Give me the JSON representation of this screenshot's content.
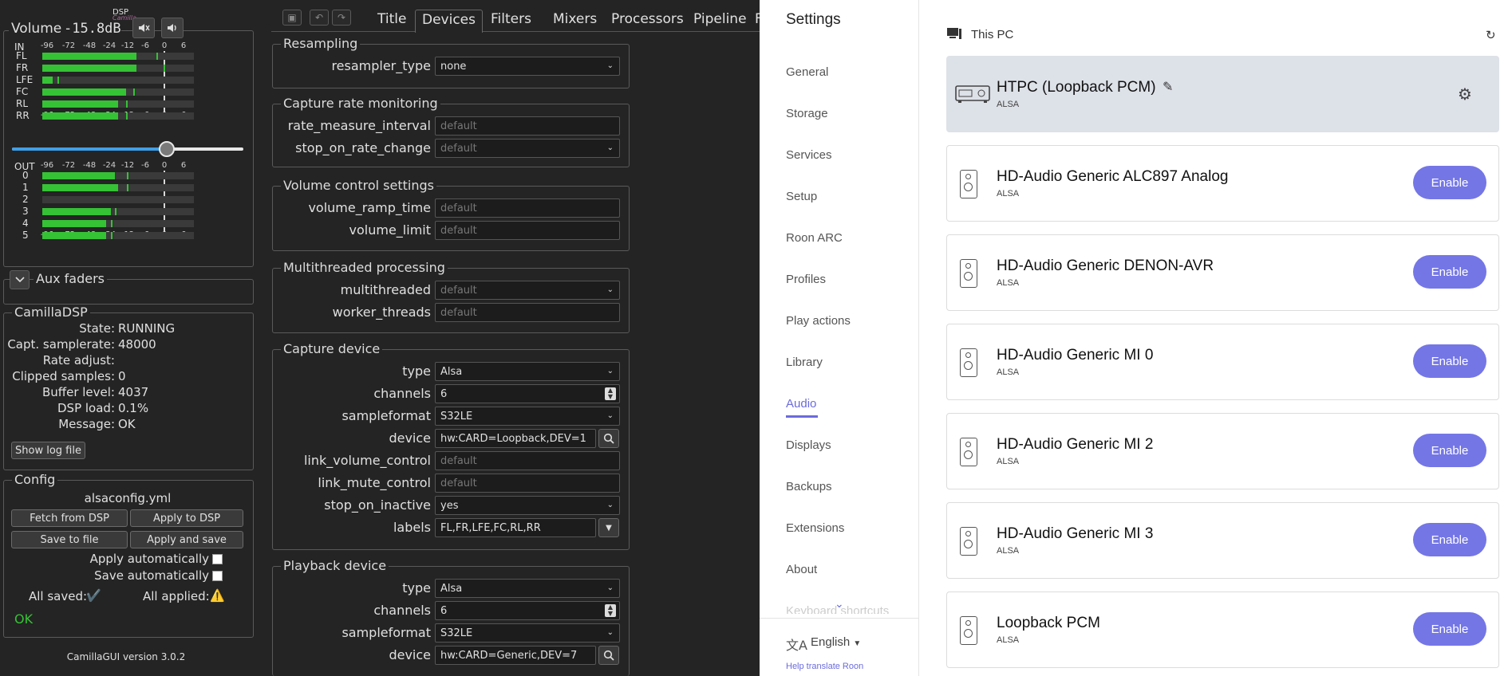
{
  "camilla": {
    "volume_label": "Volume",
    "volume_value": "-15.8dB",
    "dsp_logo": "DSP",
    "dsp_logo_sub": "Camilla",
    "volume_fraction": 0.67,
    "in_header": "IN",
    "out_header": "OUT",
    "db_ticks": [
      "-96",
      "-72",
      "-48",
      "-24",
      "-12",
      "-6",
      "0",
      "6"
    ],
    "in_channels": [
      {
        "label": "FL",
        "level": 0.62,
        "peak": 0.75
      },
      {
        "label": "FR",
        "level": 0.62,
        "peak": 0.8
      },
      {
        "label": "LFE",
        "level": 0.07,
        "peak": 0.1
      },
      {
        "label": "FC",
        "level": 0.55,
        "peak": 0.6
      },
      {
        "label": "RL",
        "level": 0.5,
        "peak": 0.55
      },
      {
        "label": "RR",
        "level": 0.5,
        "peak": 0.55
      }
    ],
    "out_channels": [
      {
        "label": "0",
        "level": 0.48,
        "peak": 0.56
      },
      {
        "label": "1",
        "level": 0.5,
        "peak": 0.56
      },
      {
        "label": "2",
        "level": 0.0,
        "peak": 0.0
      },
      {
        "label": "3",
        "level": 0.45,
        "peak": 0.48
      },
      {
        "label": "4",
        "level": 0.42,
        "peak": 0.45
      },
      {
        "label": "5",
        "level": 0.42,
        "peak": 0.45
      }
    ],
    "aux_label": "Aux faders",
    "status": {
      "title": "CamillaDSP",
      "rows": [
        {
          "k": "State:",
          "v": "RUNNING"
        },
        {
          "k": "Capt. samplerate:",
          "v": "48000"
        },
        {
          "k": "Rate adjust:",
          "v": ""
        },
        {
          "k": "Clipped samples:",
          "v": "0"
        },
        {
          "k": "Buffer level:",
          "v": "4037"
        },
        {
          "k": "DSP load:",
          "v": "0.1%"
        },
        {
          "k": "Message:",
          "v": "OK"
        }
      ],
      "log_button": "Show log file"
    },
    "config": {
      "title": "Config",
      "filename": "alsaconfig.yml",
      "fetch": "Fetch from DSP",
      "apply": "Apply to DSP",
      "save_file": "Save to file",
      "apply_save": "Apply and save",
      "apply_auto": "Apply automatically",
      "save_auto": "Save automatically",
      "all_saved": "All saved:",
      "saved_mark": "✔️",
      "all_applied": "All applied:",
      "applied_mark": "⚠️",
      "ok": "OK"
    },
    "version": "CamillaGUI version 3.0.2",
    "tabs": [
      "Title",
      "Devices",
      "Filters",
      "Mixers",
      "Processors",
      "Pipeline",
      "F"
    ],
    "active_tab": "Devices",
    "form": {
      "resampling": {
        "title": "Resampling",
        "resampler_type_label": "resampler_type",
        "resampler_type": "none"
      },
      "rate_mon": {
        "title": "Capture rate monitoring",
        "interval_label": "rate_measure_interval",
        "interval": "default",
        "stop_label": "stop_on_rate_change",
        "stop": "default"
      },
      "volume": {
        "title": "Volume control settings",
        "ramp_label": "volume_ramp_time",
        "ramp": "default",
        "limit_label": "volume_limit",
        "limit": "default"
      },
      "mt": {
        "title": "Multithreaded processing",
        "mt_label": "multithreaded",
        "mt": "default",
        "workers_label": "worker_threads",
        "workers": "default"
      },
      "capture": {
        "title": "Capture device",
        "type_label": "type",
        "type": "Alsa",
        "channels_label": "channels",
        "channels": "6",
        "fmt_label": "sampleformat",
        "fmt": "S32LE",
        "device_label": "device",
        "device": "hw:CARD=Loopback,DEV=1",
        "lvc_label": "link_volume_control",
        "lvc": "default",
        "lmc_label": "link_mute_control",
        "lmc": "default",
        "soi_label": "stop_on_inactive",
        "soi": "yes",
        "labels_label": "labels",
        "labels": "FL,FR,LFE,FC,RL,RR"
      },
      "playback": {
        "title": "Playback device",
        "type_label": "type",
        "type": "Alsa",
        "channels_label": "channels",
        "channels": "6",
        "fmt_label": "sampleformat",
        "fmt": "S32LE",
        "device_label": "device",
        "device": "hw:CARD=Generic,DEV=7"
      }
    }
  },
  "roon": {
    "settings_title": "Settings",
    "nav": [
      "General",
      "Storage",
      "Services",
      "Setup",
      "Roon ARC",
      "Profiles",
      "Play actions",
      "Library",
      "Audio",
      "Displays",
      "Backups",
      "Extensions",
      "About",
      "Keyboard shortcuts"
    ],
    "active_nav": "Audio",
    "language": "English",
    "help_translate": "Help translate Roon",
    "pc_label": "This PC",
    "devices": [
      {
        "name": "HTPC (Loopback PCM)",
        "sub": "ALSA",
        "selected": true
      },
      {
        "name": "HD-Audio Generic ALC897 Analog",
        "sub": "ALSA",
        "action": "Enable"
      },
      {
        "name": "HD-Audio Generic DENON-AVR",
        "sub": "ALSA",
        "action": "Enable"
      },
      {
        "name": "HD-Audio Generic MI 0",
        "sub": "ALSA",
        "action": "Enable"
      },
      {
        "name": "HD-Audio Generic MI 2",
        "sub": "ALSA",
        "action": "Enable"
      },
      {
        "name": "HD-Audio Generic MI 3",
        "sub": "ALSA",
        "action": "Enable"
      },
      {
        "name": "Loopback  PCM",
        "sub": "ALSA",
        "action": "Enable"
      }
    ]
  }
}
